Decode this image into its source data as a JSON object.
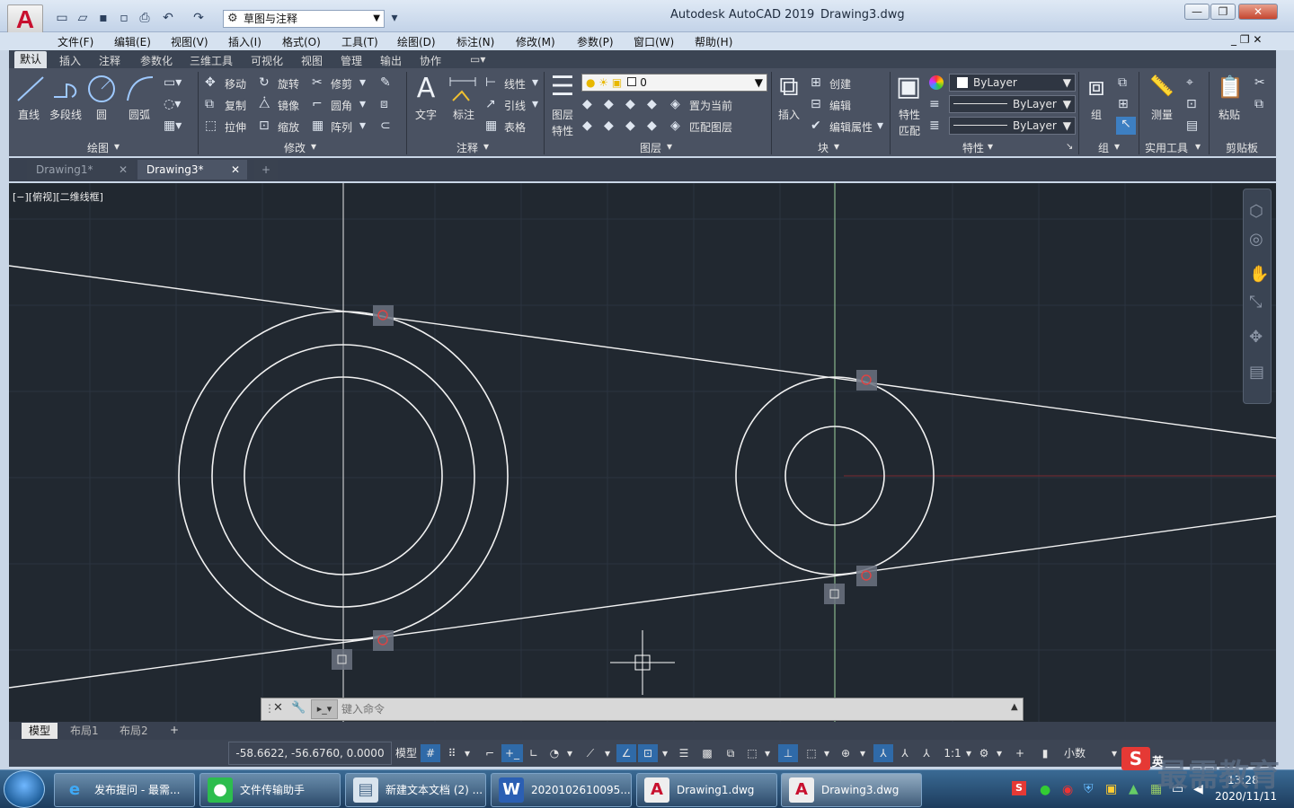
{
  "window": {
    "app_title": "Autodesk AutoCAD 2019",
    "file_title": "Drawing3.dwg",
    "workspace": "草图与注释"
  },
  "menubar": [
    "文件(F)",
    "编辑(E)",
    "视图(V)",
    "插入(I)",
    "格式(O)",
    "工具(T)",
    "绘图(D)",
    "标注(N)",
    "修改(M)",
    "参数(P)",
    "窗口(W)",
    "帮助(H)"
  ],
  "ribbon_tabs": [
    "默认",
    "插入",
    "注释",
    "参数化",
    "三维工具",
    "可视化",
    "视图",
    "管理",
    "输出",
    "协作"
  ],
  "ribbon": {
    "draw": {
      "line": "直线",
      "polyline": "多段线",
      "circle": "圆",
      "arc": "圆弧",
      "title": "绘图"
    },
    "modify": {
      "move": "移动",
      "rotate": "旋转",
      "trim": "修剪",
      "copy": "复制",
      "mirror": "镜像",
      "fillet": "圆角",
      "stretch": "拉伸",
      "scale": "缩放",
      "array": "阵列",
      "title": "修改"
    },
    "annotation": {
      "text": "文字",
      "dimension": "标注",
      "linear": "线性",
      "leader": "引线",
      "table": "表格",
      "title": "注释"
    },
    "layers": {
      "layer_props": "图层",
      "layer_props2": "特性",
      "current_layer": "0",
      "set_current": "置为当前",
      "match_layer": "匹配图层",
      "title": "图层"
    },
    "block": {
      "insert": "插入",
      "create": "创建",
      "edit": "编辑",
      "edit_attr": "编辑属性",
      "title": "块"
    },
    "properties": {
      "match": "特性",
      "match2": "匹配",
      "color": "ByLayer",
      "linetype": "ByLayer",
      "lineweight": "ByLayer",
      "title": "特性"
    },
    "group": {
      "group": "组",
      "title": "组"
    },
    "utilities": {
      "measure": "测量",
      "title": "实用工具"
    },
    "clipboard": {
      "paste": "粘贴",
      "title": "剪贴板"
    }
  },
  "doc_tabs": [
    "Drawing1*",
    "Drawing3*"
  ],
  "viewport_label": "[−][俯视][二维线框]",
  "command": {
    "placeholder": "键入命令"
  },
  "layout_tabs": [
    "模型",
    "布局1",
    "布局2"
  ],
  "status": {
    "coords": "-58.6622, -56.6760, 0.0000",
    "model": "模型",
    "scale": "1:1",
    "units": "小数"
  },
  "taskbar": {
    "items": [
      "发布提问 - 最需...",
      "文件传输助手",
      "新建文本文档 (2) ...",
      "2020102610095...",
      "Drawing1.dwg",
      "Drawing3.dwg"
    ],
    "ime": "英",
    "time": "13:28",
    "date": "2020/11/11"
  },
  "watermark": "最需教育",
  "colors": {
    "canvas": "#212830",
    "ribbon": "#4a5262",
    "autocad_red": "#c8102e"
  }
}
